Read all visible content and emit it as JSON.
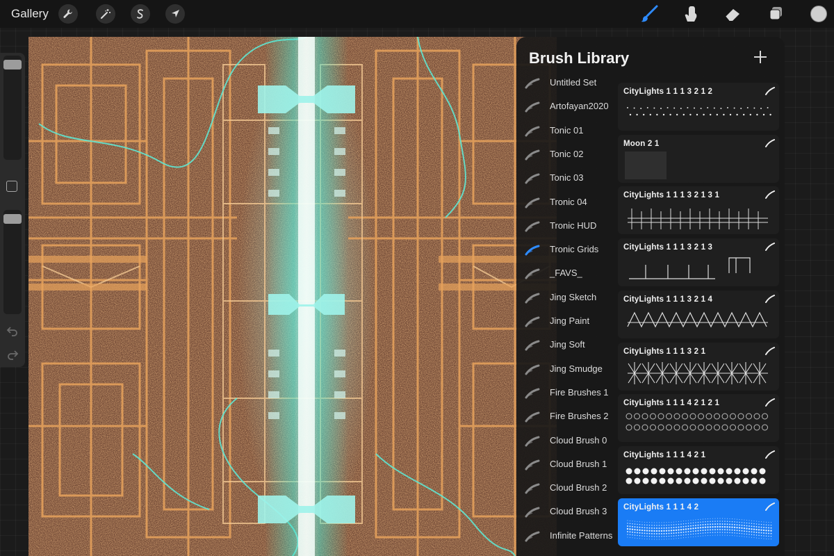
{
  "toolbar": {
    "gallery_label": "Gallery",
    "left_tools": [
      {
        "name": "actions",
        "icon": "wrench-icon"
      },
      {
        "name": "adjustments",
        "icon": "magic-wand-icon"
      },
      {
        "name": "selection",
        "icon": "selection-s-icon"
      },
      {
        "name": "transform",
        "icon": "arrow-cursor-icon"
      }
    ],
    "right_tools": [
      {
        "name": "brush",
        "icon": "paintbrush-icon",
        "active": true
      },
      {
        "name": "smudge",
        "icon": "smudge-finger-icon"
      },
      {
        "name": "eraser",
        "icon": "eraser-icon"
      },
      {
        "name": "layers",
        "icon": "layers-icon"
      }
    ],
    "current_color": "#cfcfcf",
    "active_color": "#2e8bff"
  },
  "sidebar": {
    "brush_size_icon": "size-slider",
    "modify_icon": "square-modify-icon",
    "opacity_icon": "opacity-slider",
    "undo_icon": "undo-icon",
    "redo_icon": "redo-icon"
  },
  "brush_library": {
    "title": "Brush Library",
    "add_icon": "plus-icon",
    "sets": [
      {
        "label": "Untitled Set"
      },
      {
        "label": "Artofayan2020"
      },
      {
        "label": "Tonic 01"
      },
      {
        "label": "Tonic 02"
      },
      {
        "label": "Tonic 03"
      },
      {
        "label": "Tronic 04"
      },
      {
        "label": "Tronic HUD"
      },
      {
        "label": "Tronic Grids",
        "active": true
      },
      {
        "label": "_FAVS_"
      },
      {
        "label": "Jing Sketch"
      },
      {
        "label": "Jing Paint"
      },
      {
        "label": "Jing Soft"
      },
      {
        "label": "Jing Smudge"
      },
      {
        "label": "Fire Brushes 1"
      },
      {
        "label": "Fire Brushes 2"
      },
      {
        "label": "Cloud Brush 0"
      },
      {
        "label": "Cloud Brush 1"
      },
      {
        "label": "Cloud Brush 2"
      },
      {
        "label": "Cloud Brush 3"
      },
      {
        "label": "Infinite Patterns"
      }
    ],
    "brushes": [
      {
        "name": "CityLights 1 1 1 3 2 1 2",
        "preview": "dots"
      },
      {
        "name": "Moon 2 1",
        "preview": "soft"
      },
      {
        "name": "CityLights 1 1 1 3 2 1 3 1",
        "preview": "grid"
      },
      {
        "name": "CityLights 1 1 1 3 2 1 3",
        "preview": "bars"
      },
      {
        "name": "CityLights 1 1 1 3 2 1 4",
        "preview": "zigzag"
      },
      {
        "name": "CityLights 1 1 1 3 2 1",
        "preview": "stars"
      },
      {
        "name": "CityLights 1 1 1 4 2 1 2 1",
        "preview": "circles"
      },
      {
        "name": "CityLights 1 1 1 4 2 1",
        "preview": "filled-dots"
      },
      {
        "name": "CityLights 1 1 1 4 2",
        "preview": "halftone",
        "selected": true
      }
    ]
  }
}
